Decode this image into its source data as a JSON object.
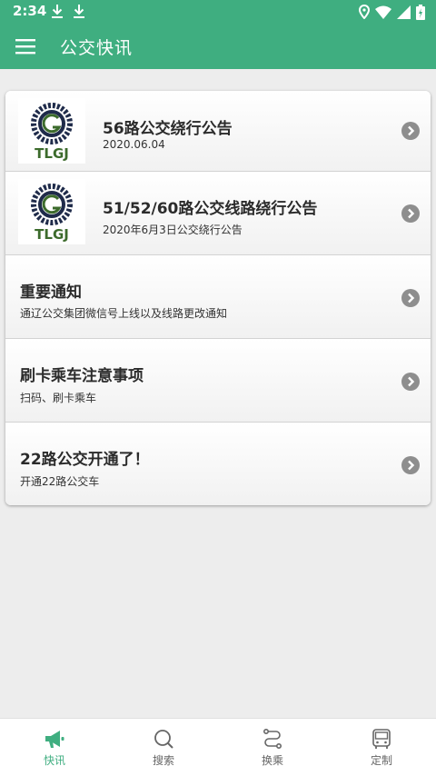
{
  "status_bar": {
    "time": "2:34"
  },
  "app_bar": {
    "title": "公交快讯"
  },
  "news": [
    {
      "title": "56路公交绕行公告",
      "subtitle": "2020.06.04",
      "thumb_text": "TLGJ"
    },
    {
      "title": "51/52/60路公交线路绕行公告",
      "subtitle": "2020年6月3日公交绕行公告",
      "thumb_text": "TLGJ"
    },
    {
      "title": "重要通知",
      "subtitle": "通辽公交集团微信号上线以及线路更改通知"
    },
    {
      "title": "刷卡乘车注意事项",
      "subtitle": "扫码、刷卡乘车"
    },
    {
      "title": "22路公交开通了！",
      "subtitle": "开通22路公交车"
    }
  ],
  "nav": [
    {
      "label": "快讯",
      "icon": "megaphone-icon",
      "active": true
    },
    {
      "label": "搜索",
      "icon": "search-icon",
      "active": false
    },
    {
      "label": "换乘",
      "icon": "transfer-route-icon",
      "active": false
    },
    {
      "label": "定制",
      "icon": "bus-icon",
      "active": false
    }
  ],
  "colors": {
    "brand": "#3fae80",
    "chevron": "#8e8e8e",
    "logo_green": "#3c6b2c",
    "logo_dark": "#1f2b4a"
  }
}
